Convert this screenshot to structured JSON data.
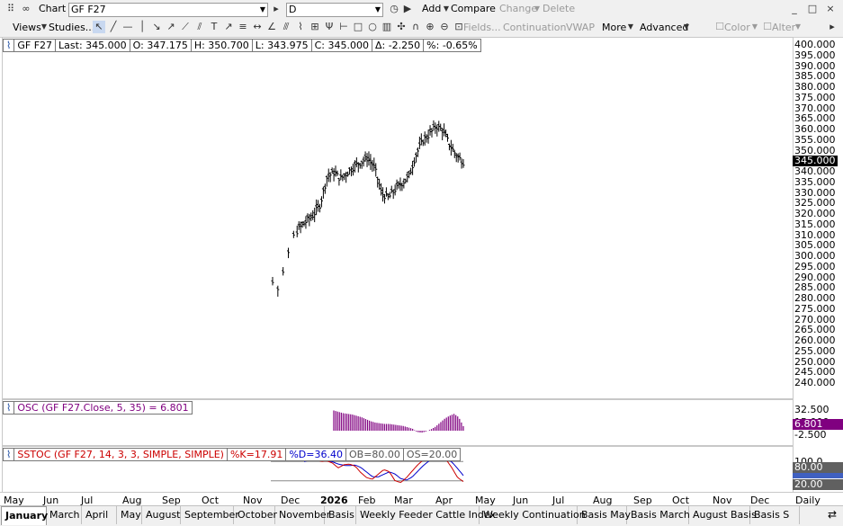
{
  "window": {
    "title": "Chart",
    "symbol_value": "GF F27",
    "interval_value": "D",
    "controls": [
      "_",
      "□",
      "×"
    ]
  },
  "toolbar1": {
    "add": "Add",
    "compare": "Compare",
    "change": "Change",
    "delete": "Delete"
  },
  "toolbar2": {
    "views": "Views",
    "studies": "Studies...",
    "fields": "Fields...",
    "continuation": "Continuation",
    "vwap": "VWAP",
    "more": "More",
    "advanced": "Advanced",
    "color": "Color",
    "alter": "Alter",
    "tool_icons": [
      "pointer-icon",
      "line-draw-icon",
      "horizontal-line-icon",
      "vertical-line-icon",
      "arrow-icon",
      "trend-arrow-icon",
      "text-icon",
      "rectangle-icon",
      "ellipse-icon",
      "bars-icon",
      "cross-icon",
      "zoom-in-icon",
      "zoom-out-icon",
      "fit-icon"
    ]
  },
  "price_panel": {
    "info": {
      "symbol": "GF F27",
      "last": "Last: 345.000",
      "open": "O: 347.175",
      "high": "H: 350.700",
      "low": "L: 343.975",
      "close": "C: 345.000",
      "delta": "Δ: -2.250",
      "pct": "%: -0.65%"
    },
    "last_badge": "345.000",
    "y_ticks": [
      "400.000",
      "395.000",
      "390.000",
      "385.000",
      "380.000",
      "375.000",
      "370.000",
      "365.000",
      "360.000",
      "355.000",
      "350.000",
      "345.000",
      "340.000",
      "335.000",
      "330.000",
      "325.000",
      "320.000",
      "315.000",
      "310.000",
      "305.000",
      "300.000",
      "295.000",
      "290.000",
      "285.000",
      "280.000",
      "275.000",
      "270.000",
      "265.000",
      "260.000",
      "255.000",
      "250.000",
      "245.000",
      "240.000"
    ]
  },
  "osc_panel": {
    "label": "OSC (GF F27.Close, 5, 35) = 6.801",
    "badge": "6.801",
    "y_ticks": [
      "32.500",
      "15.000",
      "-2.500"
    ]
  },
  "sstoc_panel": {
    "label_study": "SSTOC (GF F27, 14, 3, 3, SIMPLE, SIMPLE)",
    "label_k": "%K=17.91",
    "label_d": "%D=36.40",
    "label_ob": "OB=80.00",
    "label_os": "OS=20.00",
    "badge_ob": "80.00",
    "badge_os": "20.00",
    "y_ticks": [
      "100.0"
    ]
  },
  "time_axis": {
    "months": [
      "May",
      "Jun",
      "Jul",
      "Aug",
      "Sep",
      "Oct",
      "Nov",
      "Dec",
      "2026",
      "Feb",
      "Mar",
      "Apr",
      "May",
      "Jun",
      "Jul",
      "Aug",
      "Sep",
      "Oct",
      "Nov",
      "Dec"
    ],
    "period": "Daily"
  },
  "tabs": [
    "January",
    "March",
    "April",
    "May",
    "August",
    "September",
    "October",
    "November",
    "Basis",
    "Weekly Feeder Cattle Index",
    "Weekly Continuation",
    "Basis May",
    "Basis March",
    "August Basis",
    "Basis S"
  ],
  "colors": {
    "osc_bar": "#800080",
    "k_line": "#cc0000",
    "d_line": "#0000cc",
    "badge_bg": "#800080"
  },
  "chart_data": {
    "type": "line",
    "title": "GF F27",
    "x": [
      "2025-11-15",
      "2025-11-20",
      "2025-11-25",
      "2025-12-01",
      "2025-12-05",
      "2025-12-10",
      "2025-12-15",
      "2025-12-20",
      "2026-01-02",
      "2026-01-08",
      "2026-01-15",
      "2026-01-22",
      "2026-01-29",
      "2026-02-05",
      "2026-02-12",
      "2026-02-19",
      "2026-02-26",
      "2026-03-05",
      "2026-03-10",
      "2026-03-16",
      "2026-03-20",
      "2026-03-26",
      "2026-04-02",
      "2026-04-08",
      "2026-04-14",
      "2026-04-17",
      "2026-04-20",
      "2026-04-22",
      "2026-04-24"
    ],
    "series": [
      {
        "name": "GF F27",
        "values": [
          288,
          284,
          300,
          310,
          314,
          317,
          320,
          325,
          338,
          340,
          337,
          340,
          343,
          345,
          347,
          342,
          330,
          328,
          332,
          335,
          338,
          348,
          355,
          358,
          362,
          360,
          353,
          348,
          345
        ]
      }
    ],
    "ylim": [
      240,
      400
    ],
    "osc_values": [
      30,
      28,
      26,
      25,
      24,
      22,
      20,
      17,
      14,
      12,
      11,
      10,
      10,
      9,
      8,
      7,
      5,
      3,
      -2,
      -3,
      -1,
      2,
      6,
      12,
      18,
      22,
      25,
      20,
      6.8
    ],
    "stoch_k": [
      85,
      88,
      86,
      80,
      82,
      75,
      60,
      70,
      72,
      65,
      45,
      30,
      25,
      40,
      55,
      48,
      20,
      15,
      30,
      50,
      70,
      85,
      92,
      94,
      90,
      85,
      60,
      30,
      17.91
    ],
    "stoch_d": [
      80,
      84,
      86,
      84,
      82,
      79,
      72,
      68,
      67,
      69,
      61,
      47,
      33,
      32,
      40,
      48,
      41,
      27,
      22,
      32,
      50,
      68,
      82,
      90,
      92,
      90,
      78,
      58,
      36.4
    ]
  }
}
